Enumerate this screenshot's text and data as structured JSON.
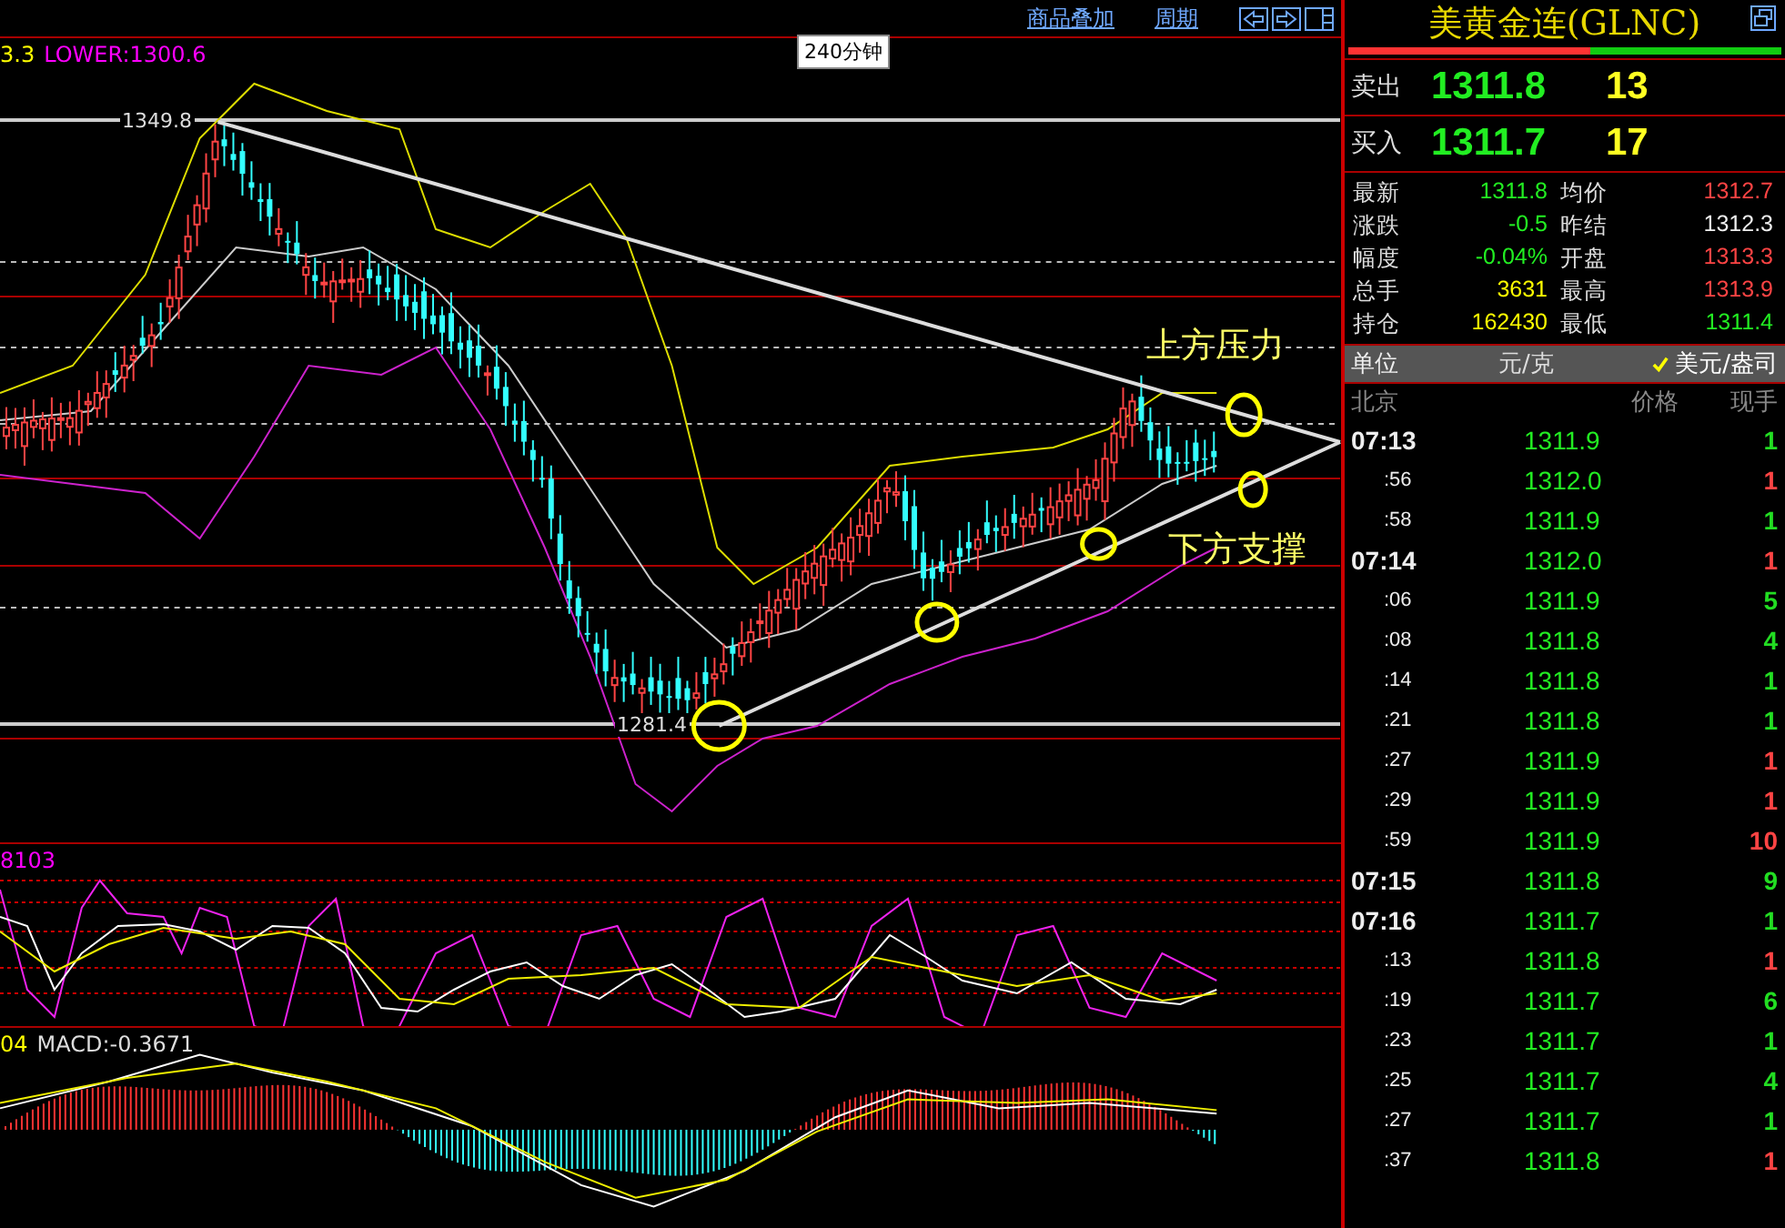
{
  "toolbar": {
    "links": [
      "商品叠加",
      "周期"
    ]
  },
  "main_chart": {
    "legend": [
      {
        "text": "3.3",
        "color": "#ffff00"
      },
      {
        "text": "LOWER:1300.6",
        "color": "#ff00ff"
      }
    ],
    "period_label": "240分钟",
    "high_label": "1349.8",
    "low_label": "1281.4",
    "resistance_label": "上方压力",
    "support_label": "下方支撑"
  },
  "kdj_panel": {
    "legend": [
      {
        "text": "8103",
        "color": "#ff00ff"
      }
    ]
  },
  "macd_panel": {
    "legend": [
      {
        "text": "04",
        "color": "#ffff00"
      },
      {
        "text": "MACD:-0.3671",
        "color": "#dddddd"
      }
    ]
  },
  "quote": {
    "title": "美黄金连(GLNC)",
    "ratio": {
      "level": 0.56
    },
    "ask": {
      "label": "卖出",
      "price": "1311.8",
      "volume": "13"
    },
    "bid": {
      "label": "买入",
      "price": "1311.7",
      "volume": "17"
    },
    "stats": [
      {
        "label": "最新",
        "value": "1311.8",
        "color": "#22ee22"
      },
      {
        "label": "均价",
        "value": "1312.7",
        "color": "#ff4444"
      },
      {
        "label": "涨跌",
        "value": "-0.5",
        "color": "#22ee22"
      },
      {
        "label": "昨结",
        "value": "1312.3",
        "color": "#eeeeee"
      },
      {
        "label": "幅度",
        "value": "-0.04%",
        "color": "#22ee22"
      },
      {
        "label": "开盘",
        "value": "1313.3",
        "color": "#ff4444"
      },
      {
        "label": "总手",
        "value": "3631",
        "color": "#ffff00"
      },
      {
        "label": "最高",
        "value": "1313.9",
        "color": "#ff4444"
      },
      {
        "label": "持仓",
        "value": "162430",
        "color": "#ffff00"
      },
      {
        "label": "最低",
        "value": "1311.4",
        "color": "#22ee22"
      }
    ],
    "unit": {
      "label": "单位",
      "options": [
        {
          "text": "元/克",
          "selected": false
        },
        {
          "text": "美元/盎司",
          "selected": true
        }
      ]
    },
    "trades_header": [
      "北京",
      "价格",
      "现手"
    ],
    "trades": [
      {
        "kind": "minute",
        "time": "07:13",
        "price": "1311.9",
        "volume": "1",
        "color": "#22dd22"
      },
      {
        "kind": "second",
        "time": ":56",
        "price": "1312.0",
        "volume": "1",
        "color": "#ff4444"
      },
      {
        "kind": "second",
        "time": ":58",
        "price": "1311.9",
        "volume": "1",
        "color": "#22dd22"
      },
      {
        "kind": "minute",
        "time": "07:14",
        "price": "1312.0",
        "volume": "1",
        "color": "#ff4444"
      },
      {
        "kind": "second",
        "time": ":06",
        "price": "1311.9",
        "volume": "5",
        "color": "#22dd22"
      },
      {
        "kind": "second",
        "time": ":08",
        "price": "1311.8",
        "volume": "4",
        "color": "#22dd22"
      },
      {
        "kind": "second",
        "time": ":14",
        "price": "1311.8",
        "volume": "1",
        "color": "#22dd22"
      },
      {
        "kind": "second",
        "time": ":21",
        "price": "1311.8",
        "volume": "1",
        "color": "#22dd22"
      },
      {
        "kind": "second",
        "time": ":27",
        "price": "1311.9",
        "volume": "1",
        "color": "#ff4444"
      },
      {
        "kind": "second",
        "time": ":29",
        "price": "1311.9",
        "volume": "1",
        "color": "#ff4444"
      },
      {
        "kind": "second",
        "time": ":59",
        "price": "1311.9",
        "volume": "10",
        "color": "#ff4444"
      },
      {
        "kind": "minute",
        "time": "07:15",
        "price": "1311.8",
        "volume": "9",
        "color": "#22dd22"
      },
      {
        "kind": "minute",
        "time": "07:16",
        "price": "1311.7",
        "volume": "1",
        "color": "#22dd22"
      },
      {
        "kind": "second",
        "time": ":13",
        "price": "1311.8",
        "volume": "1",
        "color": "#ff4444"
      },
      {
        "kind": "second",
        "time": ":19",
        "price": "1311.7",
        "volume": "6",
        "color": "#22dd22"
      },
      {
        "kind": "second",
        "time": ":23",
        "price": "1311.7",
        "volume": "1",
        "color": "#22dd22"
      },
      {
        "kind": "second",
        "time": ":25",
        "price": "1311.7",
        "volume": "4",
        "color": "#22dd22"
      },
      {
        "kind": "second",
        "time": ":27",
        "price": "1311.7",
        "volume": "1",
        "color": "#22dd22"
      },
      {
        "kind": "second",
        "time": ":37",
        "price": "1311.8",
        "volume": "1",
        "color": "#ff4444"
      }
    ]
  }
}
